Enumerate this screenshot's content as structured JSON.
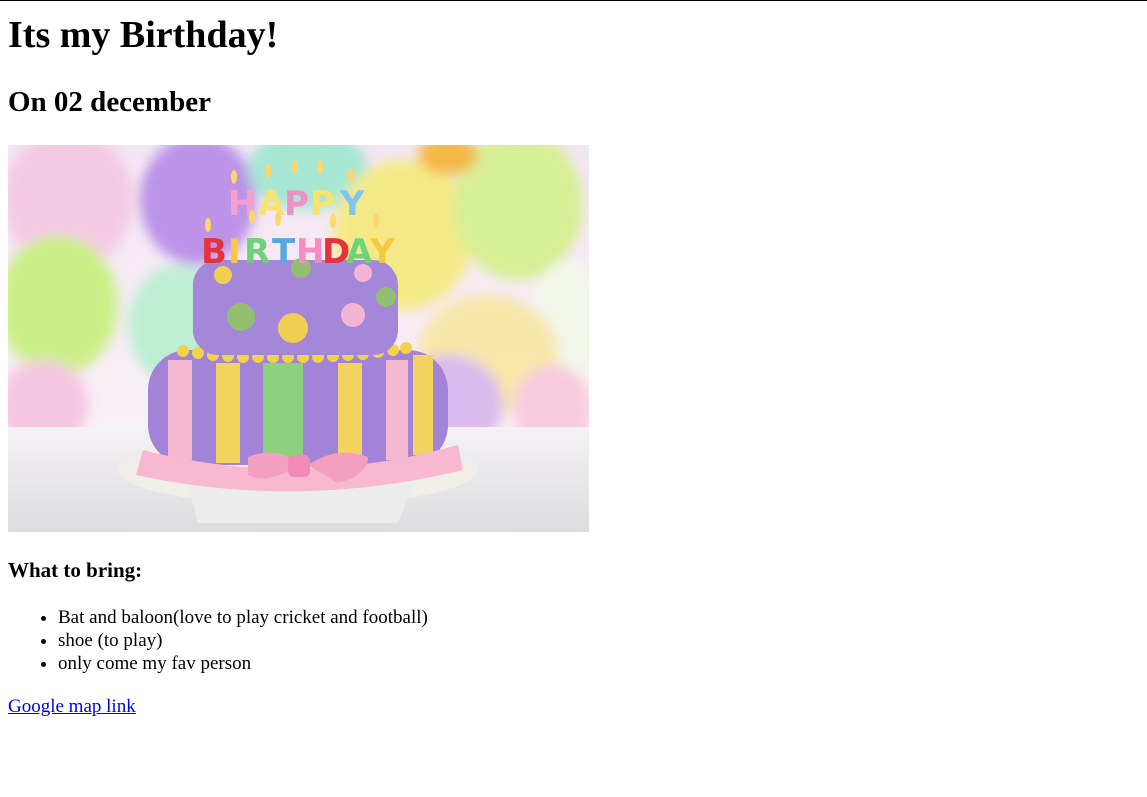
{
  "heading": "Its my Birthday!",
  "date_heading": "On 02 december",
  "image": {
    "alt": "Happy Birthday cake"
  },
  "bring_heading": "What to bring:",
  "bring_items": [
    "Bat and baloon(love to play cricket and football)",
    "shoe (to play)",
    "only come my fav person"
  ],
  "map_link": "Google map link",
  "colors": {
    "link": "#0000ee",
    "text": "#000000",
    "background": "#ffffff"
  }
}
